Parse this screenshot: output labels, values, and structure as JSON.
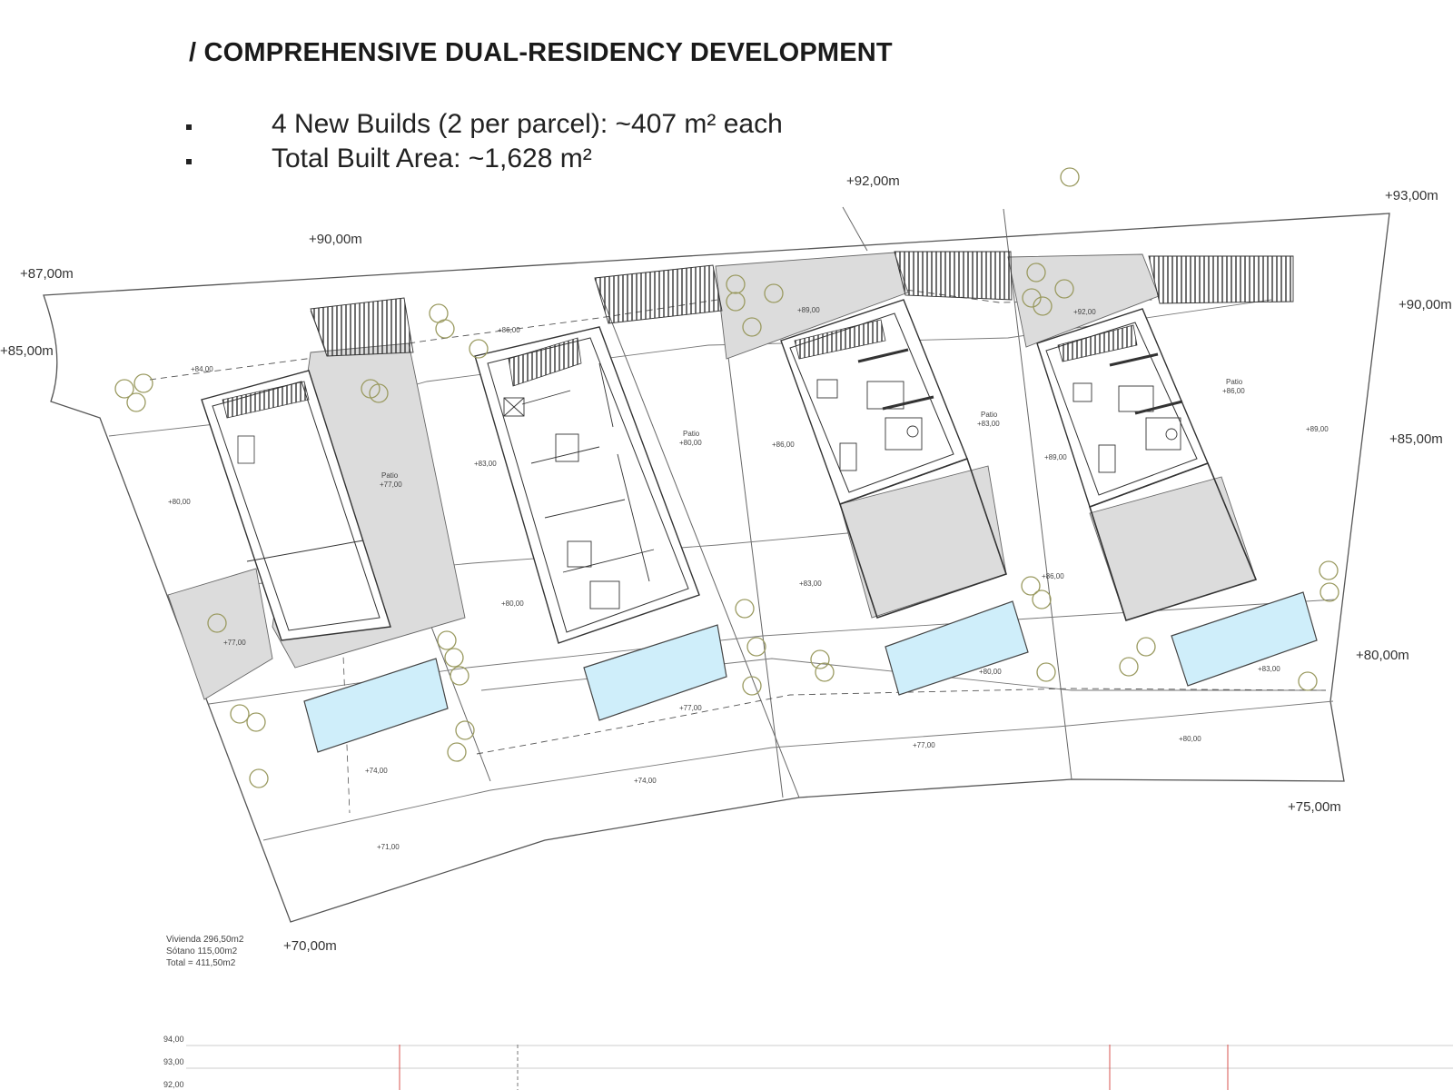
{
  "heading": "/ COMPREHENSIVE DUAL-RESIDENCY DEVELOPMENT",
  "bullets": [
    "4 New Builds (2 per parcel): ~407 m² each",
    "Total Built Area: ~1,628 m²"
  ],
  "contour_labels": {
    "c92": "+92,00m",
    "c93": "+93,00m",
    "c90a": "+90,00m",
    "c87": "+87,00m",
    "c85a": "+85,00m",
    "c90b": "+90,00m",
    "c85b": "+85,00m",
    "c80": "+80,00m",
    "c75": "+75,00m",
    "c70": "+70,00m"
  },
  "spot_levels": {
    "s84": "+84,00",
    "s86a": "+86,00",
    "s89a": "+89,00",
    "s92": "+92,00",
    "s80a": "+80,00",
    "s83a": "+83,00",
    "s86b": "+86,00",
    "s89b": "+89,00",
    "s89c": "+89,00",
    "s77a": "+77,00",
    "s80b": "+80,00",
    "s83b": "+83,00",
    "s86c": "+86,00",
    "s74a": "+74,00",
    "s77b": "+77,00",
    "s80c": "+80,00",
    "s83c": "+83,00",
    "s71": "+71,00",
    "s74b": "+74,00",
    "s77c": "+77,00",
    "s80d": "+80,00"
  },
  "patios": [
    {
      "label": "Patio",
      "level": "+77,00"
    },
    {
      "label": "Patio",
      "level": "+80,00"
    },
    {
      "label": "Patio",
      "level": "+83,00"
    },
    {
      "label": "Patio",
      "level": "+86,00"
    }
  ],
  "area_stats": {
    "vivienda": "Vivienda 296,50m2",
    "sotano": "Sótano 115,00m2",
    "total": "Total = 411,50m2"
  },
  "section_levels": [
    "94,00",
    "93,00",
    "92,00"
  ],
  "colors": {
    "line": "#555555",
    "hatch_fill": "#dcdcdc",
    "pool": "#cfeefa",
    "tree": "#9a9a60",
    "section_red": "#d9534f"
  }
}
